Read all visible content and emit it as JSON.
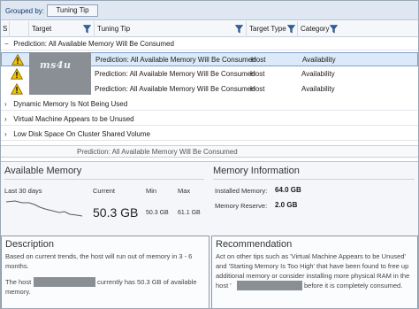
{
  "groupbar": {
    "label": "Grouped by:",
    "chip": "Tuning Tip"
  },
  "columns": {
    "s": "S",
    "target": "Target",
    "tuning_tip": "Tuning Tip",
    "target_type": "Target Type",
    "category": "Category"
  },
  "groups": [
    {
      "label": "Prediction: All Available Memory Will Be Consumed",
      "expanded": true
    },
    {
      "label": "Dynamic Memory Is Not Being Used",
      "expanded": false
    },
    {
      "label": "Virtual Machine Appears to be Unused",
      "expanded": false
    },
    {
      "label": "Low Disk Space On Cluster Shared Volume",
      "expanded": false
    }
  ],
  "rows": [
    {
      "tip": "Prediction: All Available Memory Will Be Consumed",
      "type": "Host",
      "category": "Availability",
      "selected": true
    },
    {
      "tip": "Prediction: All Available Memory Will Be Consumed",
      "type": "Host",
      "category": "Availability",
      "selected": false
    },
    {
      "tip": "Prediction: All Available Memory Will Be Consumed",
      "type": "Host",
      "category": "Availability",
      "selected": false
    }
  ],
  "watermark": "ms4u",
  "status_text": "Prediction: All Available Memory Will Be Consumed",
  "available_memory": {
    "title": "Available Memory",
    "period": "Last 30 days",
    "current_label": "Current",
    "min_label": "Min",
    "max_label": "Max",
    "current": "50.3 GB",
    "min": "50.3 GB",
    "max": "61.1 GB"
  },
  "memory_info": {
    "title": "Memory Information",
    "installed_label": "Installed Memory:",
    "installed_value": "64.0 GB",
    "reserve_label": "Memory Reserve:",
    "reserve_value": "2.0 GB"
  },
  "description": {
    "title": "Description",
    "line1": "Based on current trends, the host will run out of memory in 3 - 6",
    "line2": "months.",
    "line3a": "The host",
    "line3b": "currently has 50.3 GB of available",
    "line4": "memory."
  },
  "recommendation": {
    "title": "Recommendation",
    "line1": "Act on other tips such as 'Virtual Machine Appears to be Unused'",
    "line2": "and 'Starting Memory Is Too High' that have been found to free up",
    "line3": "additional memory or consider installing more physical RAM in the",
    "line4a": "host '",
    "line4b": "before it is completely consumed."
  },
  "colors": {
    "accent": "#1f5fa8",
    "selection": "#dbe9f8",
    "warning": "#f2c200"
  }
}
